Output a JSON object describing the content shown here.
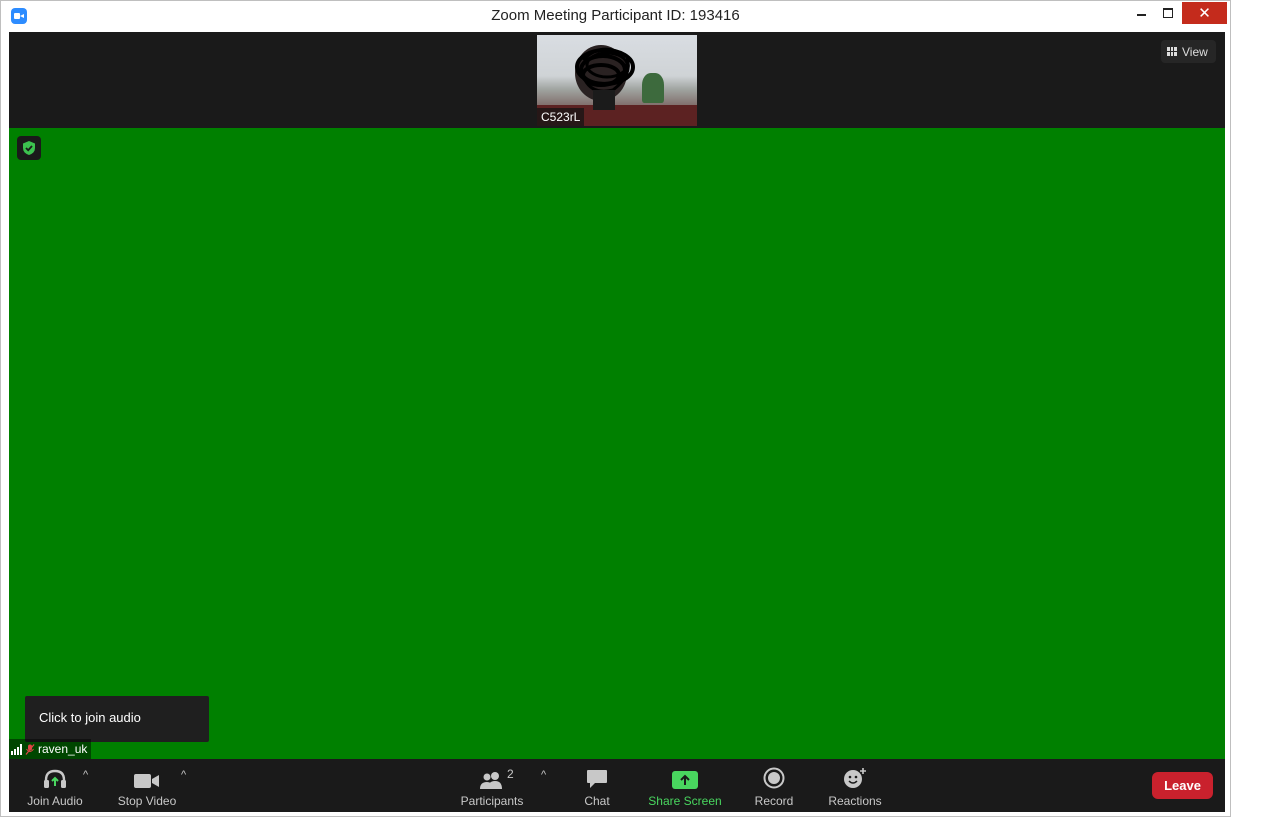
{
  "window": {
    "title": "Zoom Meeting Participant ID: 193416",
    "close_glyph": "✕"
  },
  "gallery": {
    "participant_name": "C523rL",
    "view_label": "View"
  },
  "stage": {
    "background_color": "#008000",
    "tooltip": "Click to join audio",
    "self_name": "raven_uk"
  },
  "toolbar": {
    "join_audio": "Join Audio",
    "stop_video": "Stop Video",
    "participants": "Participants",
    "participants_count": "2",
    "chat": "Chat",
    "share_screen": "Share Screen",
    "record": "Record",
    "reactions": "Reactions",
    "leave": "Leave",
    "caret": "^"
  },
  "colors": {
    "share_accent": "#49d65f",
    "leave": "#c9212d",
    "close": "#c42b1c"
  }
}
